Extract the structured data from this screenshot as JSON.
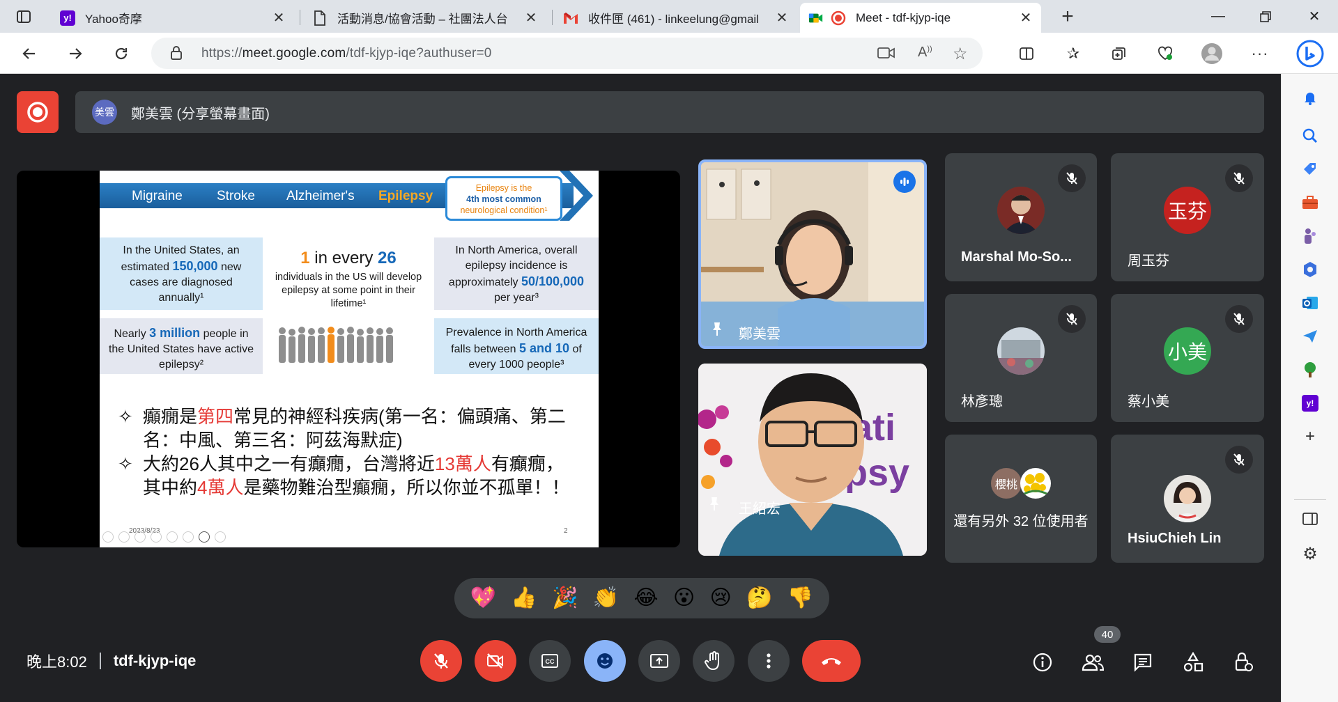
{
  "browser": {
    "tabs": [
      {
        "title": "Yahoo奇摩",
        "icon": "yahoo-icon",
        "color": "#6001d2"
      },
      {
        "title": "活動消息/協會活動 – 社團法人台",
        "icon": "document-icon"
      },
      {
        "title": "收件匣 (461) - linkeelung@gmail",
        "icon": "gmail-icon"
      },
      {
        "title": "Meet - tdf-kjyp-iqe",
        "icon": "meet-icon",
        "active": true
      }
    ],
    "url_prefix": "https://",
    "url_host": "meet.google.com",
    "url_path": "/tdf-kjyp-iqe?authuser=0"
  },
  "meet": {
    "presenter_label": "鄭美雲 (分享螢幕畫面)",
    "presenter_initials": "美雲",
    "slide": {
      "banner_items": [
        "Migraine",
        "Stroke",
        "Alzheimer's",
        "Epilepsy"
      ],
      "callout": [
        "Epilepsy is the",
        "4th most common",
        "neurological condition¹"
      ],
      "box1": {
        "pre": "In the United States, an estimated ",
        "num": "150,000",
        "post": " new cases are diagnosed annually¹"
      },
      "center": {
        "one": "1",
        "mid": " in every ",
        "num": "26",
        "sub": "individuals in the US will develop epilepsy at some point in their lifetime¹"
      },
      "box2": {
        "pre": "In North America, overall epilepsy incidence is approximately ",
        "num": "50/100,000",
        "post": " per year³"
      },
      "box3": {
        "pre": "Nearly ",
        "num": "3 million",
        "post": " people in the United States have active epilepsy²"
      },
      "box4": {
        "pre": "Prevalence in North America falls between ",
        "num": "5 and 10",
        "post": " of every 1000 people³"
      },
      "bullet1": {
        "a": "癲癇是",
        "b": "第四",
        "c": "常見的神經科疾病(第一名：偏頭痛、第二名：中風、第三名：阿茲海默症)"
      },
      "bullet2": {
        "a": "大約26人其中之一有癲癇，台灣將近",
        "b": "13萬人",
        "c": "有癲癇，其中約",
        "d": "4萬人",
        "e": "是藥物難治型癲癇，所以你並不孤單！！"
      },
      "date": "2023/8/23",
      "page": "2"
    },
    "participants": [
      {
        "name": "鄭美雲",
        "speaking": true
      },
      {
        "name": "王紹宏"
      },
      {
        "name": "Marshal Mo-So..."
      },
      {
        "name": "周玉芬",
        "initials": "玉芬",
        "color": "#c5221f"
      },
      {
        "name": "林彥璁"
      },
      {
        "name": "蔡小美",
        "initials": "小美",
        "color": "#34a853"
      },
      {
        "name": "還有另外 32 位使用者",
        "initials": "櫻桃"
      },
      {
        "name": "HsiuChieh Lin"
      }
    ],
    "reactions": [
      "💖",
      "👍",
      "🎉",
      "👏",
      "😂",
      "😮",
      "😢",
      "🤔",
      "👎"
    ],
    "time": "晚上8:02",
    "meeting_code": "tdf-kjyp-iqe",
    "participant_count": "40"
  }
}
